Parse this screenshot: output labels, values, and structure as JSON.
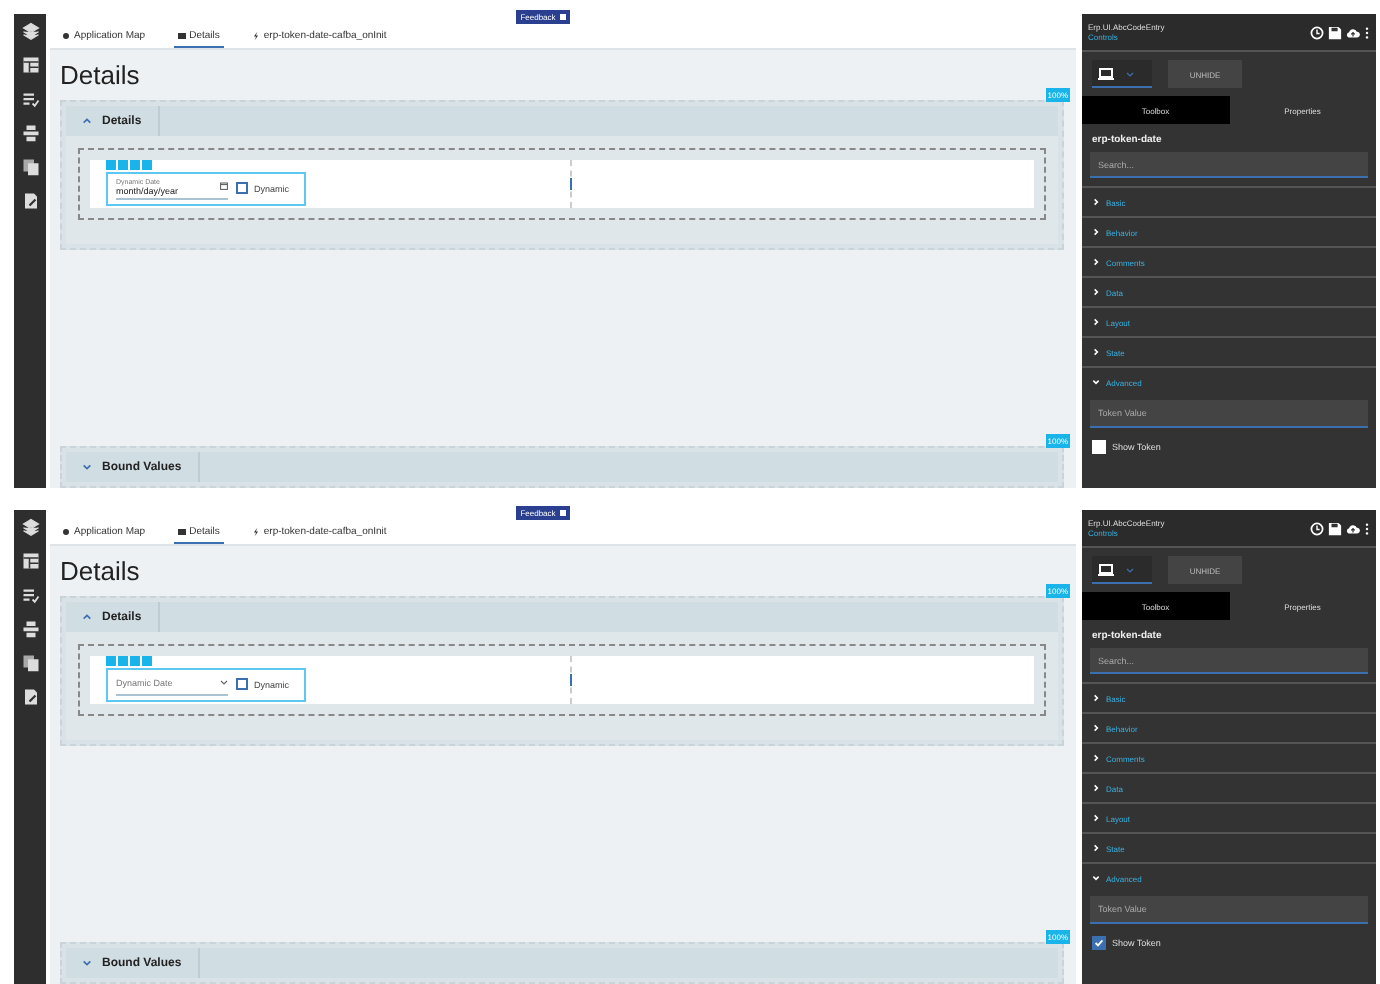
{
  "screens": [
    {
      "feedback": "Feedback",
      "tabs": [
        {
          "label": "Application Map",
          "selected": false
        },
        {
          "label": "Details",
          "selected": true
        },
        {
          "label": "erp-token-date-cafba_onInit",
          "selected": false
        }
      ],
      "page_title": "Details",
      "sections": [
        {
          "title": "Details",
          "expanded": true,
          "badge": "100%",
          "field": {
            "kind": "date",
            "label": "Dynamic Date",
            "value": "month/day/year"
          },
          "dynamic_checkbox": {
            "label": "Dynamic",
            "checked": false
          }
        },
        {
          "title": "Bound Values",
          "expanded": false,
          "badge": "100%"
        }
      ],
      "panel": {
        "title": "Erp.UI.AbcCodeEntry",
        "subtitle": "Controls",
        "unhide": "UNHIDE",
        "tabs": [
          {
            "label": "Toolbox",
            "selected": true
          },
          {
            "label": "Properties",
            "selected": false
          }
        ],
        "component": "erp-token-date",
        "search_placeholder": "Search...",
        "groups": [
          {
            "label": "Basic",
            "expanded": false
          },
          {
            "label": "Behavior",
            "expanded": false
          },
          {
            "label": "Comments",
            "expanded": false
          },
          {
            "label": "Data",
            "expanded": false
          },
          {
            "label": "Layout",
            "expanded": false
          },
          {
            "label": "State",
            "expanded": false
          },
          {
            "label": "Advanced",
            "expanded": true
          }
        ],
        "token_placeholder": "Token Value",
        "show_token": {
          "label": "Show Token",
          "checked": false
        }
      }
    },
    {
      "feedback": "Feedback",
      "tabs": [
        {
          "label": "Application Map",
          "selected": false
        },
        {
          "label": "Details",
          "selected": true
        },
        {
          "label": "erp-token-date-cafba_onInit",
          "selected": false
        }
      ],
      "page_title": "Details",
      "sections": [
        {
          "title": "Details",
          "expanded": true,
          "badge": "100%",
          "field": {
            "kind": "dropdown",
            "placeholder": "Dynamic Date"
          },
          "dynamic_checkbox": {
            "label": "Dynamic",
            "checked": false
          }
        },
        {
          "title": "Bound Values",
          "expanded": false,
          "badge": "100%"
        }
      ],
      "panel": {
        "title": "Erp.UI.AbcCodeEntry",
        "subtitle": "Controls",
        "unhide": "UNHIDE",
        "tabs": [
          {
            "label": "Toolbox",
            "selected": true
          },
          {
            "label": "Properties",
            "selected": false
          }
        ],
        "component": "erp-token-date",
        "search_placeholder": "Search...",
        "groups": [
          {
            "label": "Basic",
            "expanded": false
          },
          {
            "label": "Behavior",
            "expanded": false
          },
          {
            "label": "Comments",
            "expanded": false
          },
          {
            "label": "Data",
            "expanded": false
          },
          {
            "label": "Layout",
            "expanded": false
          },
          {
            "label": "State",
            "expanded": false
          },
          {
            "label": "Advanced",
            "expanded": true
          }
        ],
        "token_placeholder": "Token Value",
        "show_token": {
          "label": "Show Token",
          "checked": true
        }
      }
    }
  ]
}
